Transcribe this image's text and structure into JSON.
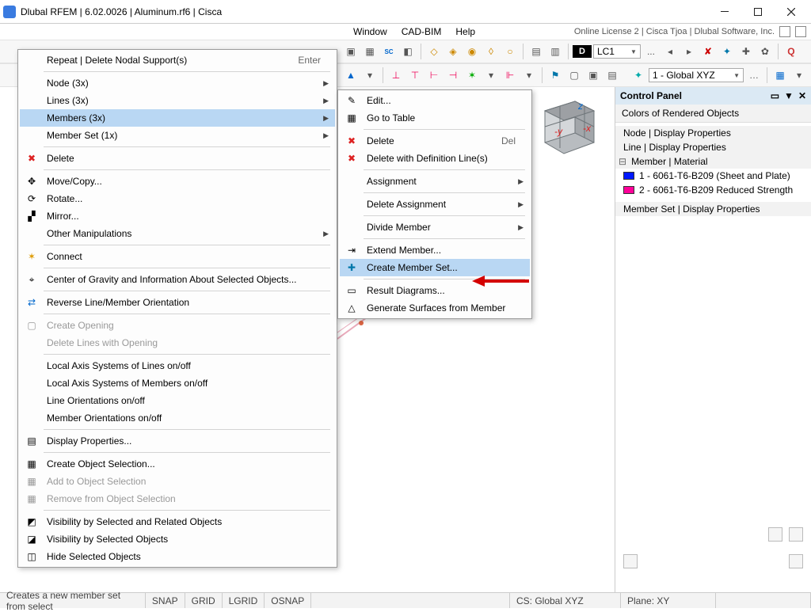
{
  "title": "Dlubal RFEM | 6.02.0026 | Aluminum.rf6 | Cisca",
  "menubar": {
    "window": "Window",
    "cadbim": "CAD-BIM",
    "help": "Help"
  },
  "menubar_right": {
    "license": "Online License 2 | Cisca Tjoa | Dlubal Software, Inc."
  },
  "toolbar": {
    "lc_tag": "D",
    "lc_text": "LC1",
    "lc_dots": "...",
    "coord": "1 - Global XYZ"
  },
  "ctx1": {
    "repeat": "Repeat | Delete Nodal Support(s)",
    "repeat_sc": "Enter",
    "node": "Node (3x)",
    "lines": "Lines (3x)",
    "members": "Members (3x)",
    "memberset": "Member Set (1x)",
    "delete": "Delete",
    "move": "Move/Copy...",
    "rotate": "Rotate...",
    "mirror": "Mirror...",
    "manip": "Other Manipulations",
    "connect": "Connect",
    "cg": "Center of Gravity and Information About Selected Objects...",
    "reverse": "Reverse Line/Member Orientation",
    "opening": "Create Opening",
    "dellines": "Delete Lines with Opening",
    "laxlines": "Local Axis Systems of Lines on/off",
    "laxmem": "Local Axis Systems of Members on/off",
    "lineori": "Line Orientations on/off",
    "memori": "Member Orientations on/off",
    "disp": "Display Properties...",
    "csel": "Create Object Selection...",
    "asel": "Add to Object Selection",
    "rsel": "Remove from Object Selection",
    "vsr": "Visibility by Selected and Related Objects",
    "vs": "Visibility by Selected Objects",
    "hide": "Hide Selected Objects"
  },
  "ctx2": {
    "edit": "Edit...",
    "gotable": "Go to Table",
    "delete": "Delete",
    "delete_sc": "Del",
    "deldef": "Delete with Definition Line(s)",
    "assign": "Assignment",
    "delassign": "Delete Assignment",
    "divide": "Divide Member",
    "extend": "Extend Member...",
    "create": "Create Member Set...",
    "result": "Result Diagrams...",
    "gensurf": "Generate Surfaces from Member"
  },
  "panel": {
    "title": "Control Panel",
    "subtitle": "Colors of Rendered Objects",
    "node": "Node | Display Properties",
    "line": "Line | Display Properties",
    "member": "Member | Material",
    "m1": "1 - 6061-T6-B209 (Sheet and Plate)",
    "m2": "2 - 6061-T6-B209 Reduced Strength",
    "mset": "Member Set | Display Properties"
  },
  "status": {
    "hint": "Creates a new member set from select",
    "snap": "SNAP",
    "grid": "GRID",
    "lgrid": "LGRID",
    "osnap": "OSNAP",
    "cs": "CS: Global XYZ",
    "plane": "Plane: XY"
  }
}
